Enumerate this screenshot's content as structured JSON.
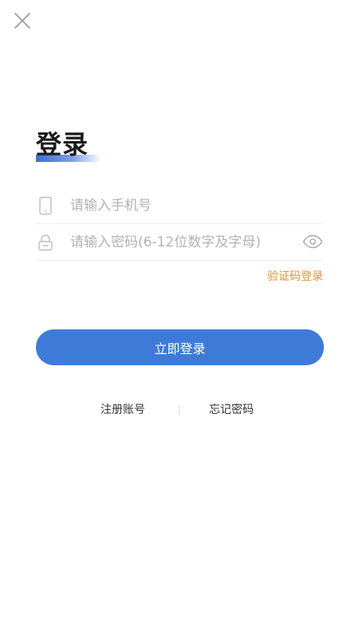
{
  "header": {
    "close_icon": "close-icon"
  },
  "title": "登录",
  "colors": {
    "primary": "#3e7bd9",
    "accent_link": "#e8912f",
    "title_underline": "#3d6fd6"
  },
  "form": {
    "phone": {
      "icon": "phone-icon",
      "placeholder": "请输入手机号",
      "value": ""
    },
    "password": {
      "icon": "lock-icon",
      "placeholder": "请输入密码(6-12位数字及字母)",
      "value": "",
      "toggle_icon": "eye-icon"
    },
    "code_login_label": "验证码登录"
  },
  "login_button_label": "立即登录",
  "footer_links": {
    "register_label": "注册账号",
    "forgot_label": "忘记密码"
  }
}
